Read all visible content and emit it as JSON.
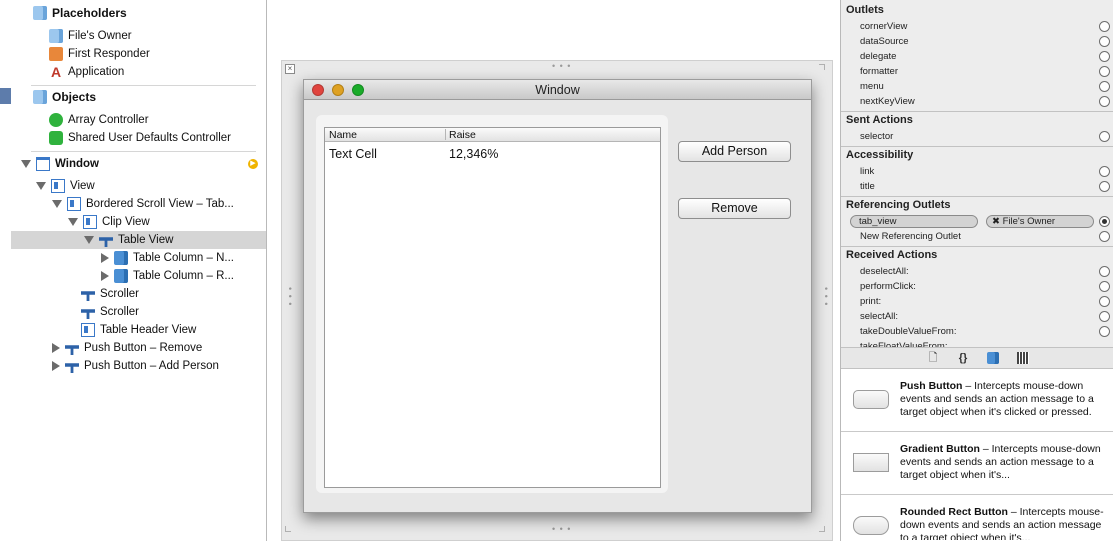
{
  "outline": {
    "placeholders_header": "Placeholders",
    "placeholders": [
      "File's Owner",
      "First Responder",
      "Application"
    ],
    "objects_header": "Objects",
    "objects": [
      "Array Controller",
      "Shared User Defaults Controller"
    ],
    "tree": {
      "window": "Window",
      "view": "View",
      "bordered_scroll_view": "Bordered Scroll View – Tab...",
      "clip_view": "Clip View",
      "table_view": "Table View",
      "table_column_1": "Table Column – N...",
      "table_column_2": "Table Column – R...",
      "scroller_1": "Scroller",
      "scroller_2": "Scroller",
      "table_header_view": "Table Header View",
      "push_button_remove": "Push Button – Remove",
      "push_button_add": "Push Button – Add Person"
    }
  },
  "canvas": {
    "window_title": "Window",
    "table": {
      "columns": [
        "Name",
        "Raise"
      ],
      "rows": [
        [
          "Text Cell",
          "12,346%"
        ]
      ]
    },
    "buttons": {
      "add": "Add Person",
      "remove": "Remove"
    }
  },
  "inspector": {
    "outlets_header": "Outlets",
    "outlets": [
      "cornerView",
      "dataSource",
      "delegate",
      "formatter",
      "menu",
      "nextKeyView"
    ],
    "sent_actions_header": "Sent Actions",
    "sent_actions": [
      "selector"
    ],
    "accessibility_header": "Accessibility",
    "accessibility": [
      "link",
      "title"
    ],
    "referencing_outlets_header": "Referencing Outlets",
    "referencing_outlet": {
      "name": "tab_view",
      "target": "File's Owner"
    },
    "new_referencing_outlet": "New Referencing Outlet",
    "received_actions_header": "Received Actions",
    "received_actions": [
      "deselectAll:",
      "performClick:",
      "print:",
      "selectAll:",
      "takeDoubleValueFrom:",
      "takeFloatValueFrom:"
    ]
  },
  "library": {
    "tab_icons": [
      "file-icon",
      "braces-icon",
      "object-cube-icon",
      "media-grid-icon"
    ],
    "items": [
      {
        "title": "Push Button",
        "desc": " – Intercepts mouse-down events and sends an action message to a target object when it's clicked or pressed."
      },
      {
        "title": "Gradient Button",
        "desc": " – Intercepts mouse-down events and sends an action message to a target object when it's..."
      },
      {
        "title": "Rounded Rect Button",
        "desc": " – Intercepts mouse-down events and sends an action message to a target object when it's..."
      }
    ]
  },
  "colors": {
    "selection": "#d5d5d5",
    "close_light": "#e0443e",
    "minimize_light": "#dea123",
    "zoom_light": "#1aab29",
    "icon_blue": "#4a8fd4"
  }
}
